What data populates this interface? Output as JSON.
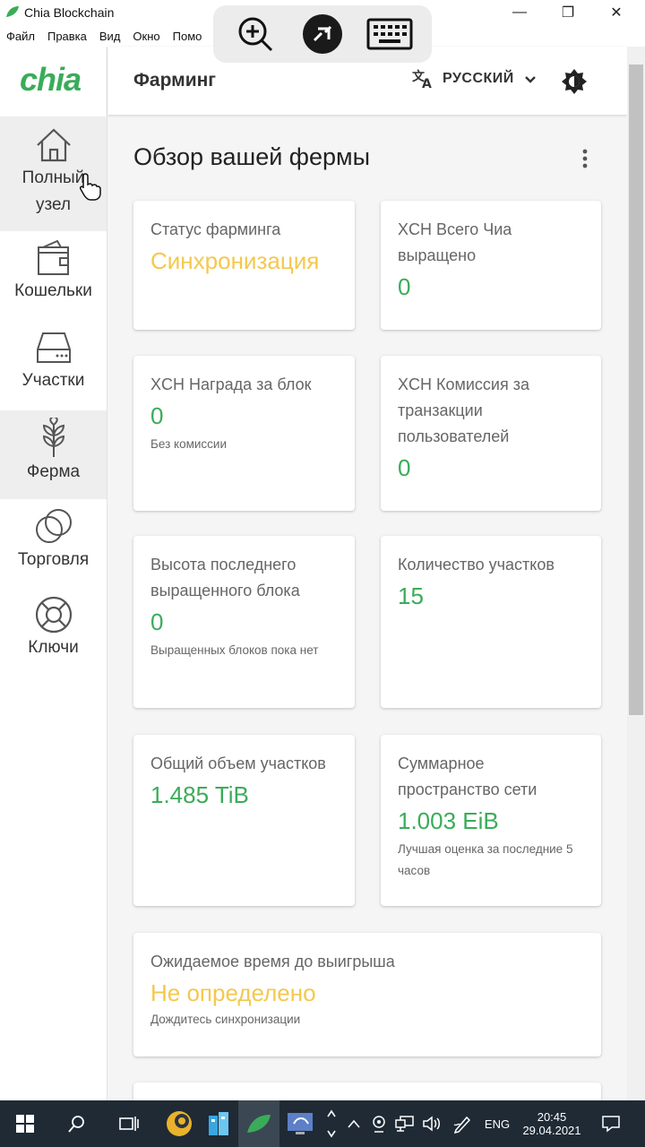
{
  "window": {
    "title": "Chia Blockchain",
    "minimize": "—",
    "restore": "❐",
    "close": "✕"
  },
  "menu": [
    "Файл",
    "Правка",
    "Вид",
    "Окно",
    "Помо"
  ],
  "sidebar": {
    "logo": "chia",
    "items": [
      {
        "label": "Полный узел",
        "icon": "home-icon"
      },
      {
        "label": "Кошельки",
        "icon": "wallet-icon"
      },
      {
        "label": "Участки",
        "icon": "hdd-icon"
      },
      {
        "label": "Ферма",
        "icon": "plant-icon"
      },
      {
        "label": "Торговля",
        "icon": "trade-icon"
      },
      {
        "label": "Ключи",
        "icon": "lifebuoy-icon"
      }
    ]
  },
  "header": {
    "title": "Фарминг",
    "language": "РУССКИЙ"
  },
  "main": {
    "title": "Обзор вашей фермы",
    "cards": [
      {
        "title": "Статус фарминга",
        "value": "Синхронизация",
        "sub": ""
      },
      {
        "title": "XCH Всего Чиа выращено",
        "value": "0",
        "sub": ""
      },
      {
        "title": "XCH Награда за блок",
        "value": "0",
        "sub": "Без комиссии"
      },
      {
        "title": "XCH Комиссия за транзакции пользователей",
        "value": "0",
        "sub": ""
      },
      {
        "title": "Высота последнего выращенного блока",
        "value": "0",
        "sub": "Выращенных блоков пока нет"
      },
      {
        "title": "Количество участков",
        "value": "15",
        "sub": ""
      },
      {
        "title": "Общий объем участков",
        "value": "1.485 TiB",
        "sub": ""
      },
      {
        "title": "Суммарное пространство сети",
        "value": "1.003 EiB",
        "sub": "Лучшая оценка за последние 5 часов"
      },
      {
        "title": "Ожидаемое время до выигрыша",
        "value": "Не определено",
        "sub": "Дождитесь синхронизации"
      }
    ]
  },
  "taskbar": {
    "lang": "ENG",
    "time": "20:45",
    "date": "29.04.2021"
  },
  "colors": {
    "accent": "#3aac59",
    "warning": "#f4c84e"
  }
}
